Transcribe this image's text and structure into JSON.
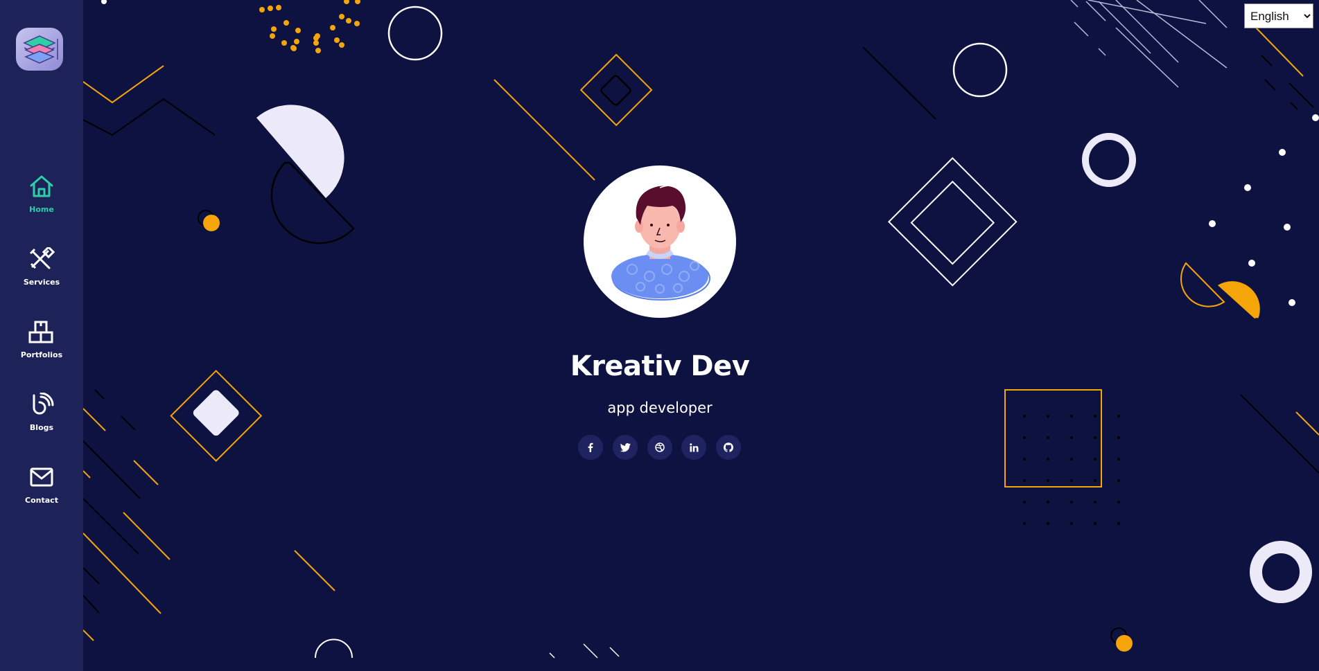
{
  "colors": {
    "background": "#0e1241",
    "sidebar": "#1d2258",
    "accent": "#2ecea7",
    "decor_orange": "#f5a50a",
    "decor_light": "#eceaf8"
  },
  "language": {
    "selected": "English",
    "options": [
      "English"
    ]
  },
  "sidebar": {
    "items": [
      {
        "label": "Home",
        "icon": "home-icon",
        "active": true
      },
      {
        "label": "Services",
        "icon": "tools-icon",
        "active": false
      },
      {
        "label": "Portfolios",
        "icon": "boxes-icon",
        "active": false
      },
      {
        "label": "Blogs",
        "icon": "blog-icon",
        "active": false
      },
      {
        "label": "Contact",
        "icon": "mail-icon",
        "active": false
      }
    ]
  },
  "profile": {
    "name": "Kreativ Dev",
    "role": "app developer"
  },
  "social": [
    {
      "icon": "facebook-icon"
    },
    {
      "icon": "twitter-icon"
    },
    {
      "icon": "dribbble-icon"
    },
    {
      "icon": "linkedin-icon"
    },
    {
      "icon": "github-icon"
    }
  ]
}
